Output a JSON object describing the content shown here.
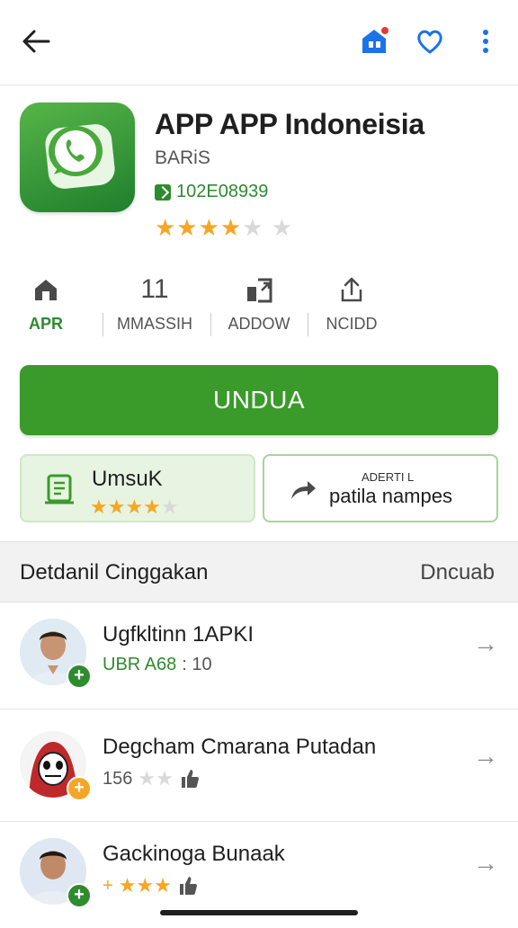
{
  "app": {
    "title": "APP APP Indoneisia",
    "developer": "BARiS",
    "id_text": "102E08939",
    "rating_stars": 4
  },
  "stats": [
    {
      "label": "APR",
      "value": "",
      "icon": "home-icon"
    },
    {
      "label": "MMASSIH",
      "value": "11",
      "icon": "count-icon"
    },
    {
      "label": "ADDOW",
      "value": "",
      "icon": "share-box-icon"
    },
    {
      "label": "NCIDD",
      "value": "",
      "icon": "upload-icon"
    }
  ],
  "install_label": "UNDUA",
  "card_left": {
    "title": "UmsuK",
    "rating": 4
  },
  "card_right": {
    "small": "ADERTI L",
    "title": "patila nampes"
  },
  "section": {
    "title": "Detdanil Cinggakan",
    "link": "Dncuab"
  },
  "list": [
    {
      "name": "Ugfkltinn 1APKI",
      "meta_green": "UBR A68",
      "meta": ": 10",
      "badge": "+"
    },
    {
      "name": "Degcham Cmarana Putadan",
      "meta": "156",
      "badge": "+"
    },
    {
      "name": "Gackinoga Bunaak",
      "meta": "+",
      "badge": "+"
    }
  ],
  "colors": {
    "accent": "#3a9a2a",
    "link_blue": "#1a73e8",
    "star": "#f5a623"
  }
}
